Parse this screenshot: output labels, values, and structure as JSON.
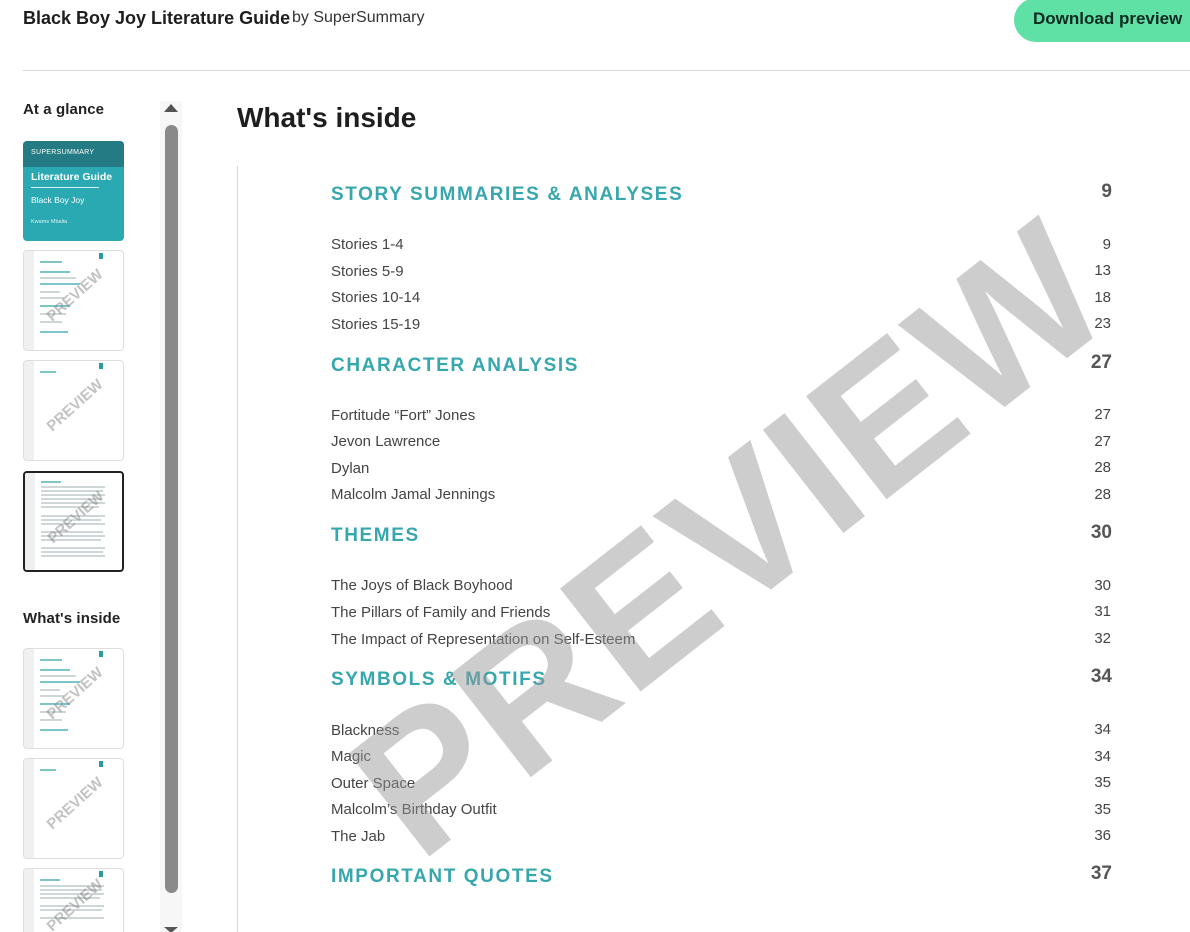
{
  "header": {
    "title": "Black Boy Joy Literature Guide",
    "byline": "by SuperSummary",
    "download_label": "Download preview",
    "download_color": "#5fe0a4"
  },
  "sidebar": {
    "at_a_glance_label": "At a glance",
    "whats_inside_label": "What's inside",
    "cover": {
      "brand": "SUPERSUMMARY",
      "guide_label": "Literature Guide",
      "book_title": "Black Boy Joy",
      "author": "Kwame Mbalia"
    },
    "thumb_watermark": "PREVIEW"
  },
  "main": {
    "title": "What's inside",
    "watermark": "PREVIEW",
    "accent_color": "#37a7ae",
    "sections": [
      {
        "title": "STORY SUMMARIES & ANALYSES",
        "page": "9",
        "items": [
          {
            "label": "Stories 1-4",
            "page": "9"
          },
          {
            "label": "Stories 5-9",
            "page": "13"
          },
          {
            "label": "Stories 10-14",
            "page": "18"
          },
          {
            "label": "Stories 15-19",
            "page": "23"
          }
        ]
      },
      {
        "title": "CHARACTER ANALYSIS",
        "page": "27",
        "items": [
          {
            "label": "Fortitude “Fort” Jones",
            "page": "27"
          },
          {
            "label": "Jevon Lawrence",
            "page": "27"
          },
          {
            "label": "Dylan",
            "page": "28"
          },
          {
            "label": "Malcolm Jamal Jennings",
            "page": "28"
          }
        ]
      },
      {
        "title": "THEMES",
        "page": "30",
        "items": [
          {
            "label": "The Joys of Black Boyhood",
            "page": "30"
          },
          {
            "label": "The Pillars of Family and Friends",
            "page": "31"
          },
          {
            "label": "The Impact of Representation on Self-Esteem",
            "page": "32"
          }
        ]
      },
      {
        "title": "SYMBOLS & MOTIFS",
        "page": "34",
        "items": [
          {
            "label": "Blackness",
            "page": "34"
          },
          {
            "label": "Magic",
            "page": "34"
          },
          {
            "label": "Outer Space",
            "page": "35"
          },
          {
            "label": "Malcolm’s Birthday Outfit",
            "page": "35"
          },
          {
            "label": "The Jab",
            "page": "36"
          }
        ]
      },
      {
        "title": "IMPORTANT QUOTES",
        "page": "37",
        "items": []
      }
    ]
  }
}
